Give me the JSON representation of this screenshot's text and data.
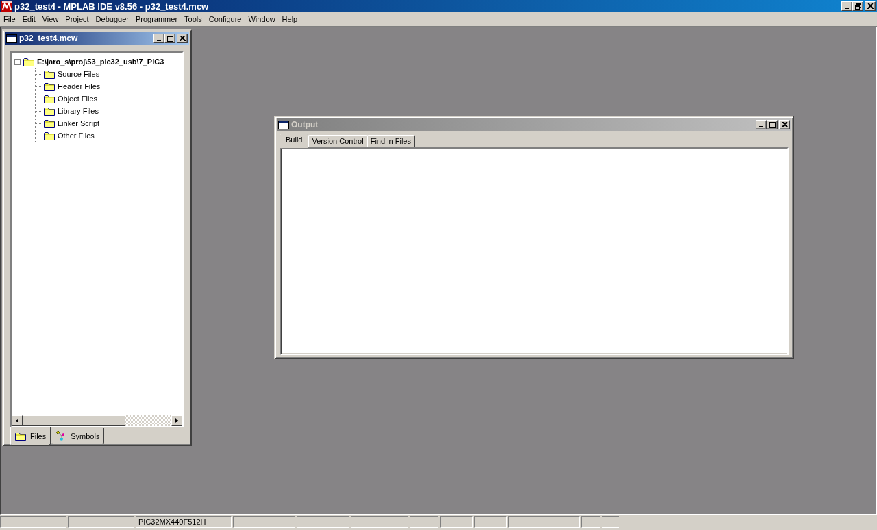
{
  "window": {
    "title": "p32_test4 - MPLAB IDE v8.56 - p32_test4.mcw"
  },
  "menu": [
    "File",
    "Edit",
    "View",
    "Project",
    "Debugger",
    "Programmer",
    "Tools",
    "Configure",
    "Window",
    "Help"
  ],
  "project_window": {
    "title": "p32_test4.mcw",
    "active": true,
    "tree": [
      {
        "label": "E:\\jaro_s\\proj\\53_pic32_usb\\7_PIC3",
        "expanded": true,
        "children": [
          {
            "label": "Source Files"
          },
          {
            "label": "Header Files"
          },
          {
            "label": "Object Files"
          },
          {
            "label": "Library Files"
          },
          {
            "label": "Linker Script"
          },
          {
            "label": "Other Files"
          }
        ]
      }
    ],
    "tabs": [
      {
        "label": "Files",
        "kind": "files",
        "selected": true
      },
      {
        "label": "Symbols",
        "kind": "symbols",
        "selected": false
      }
    ]
  },
  "output_window": {
    "title": "Output",
    "active": false,
    "tabs": [
      {
        "label": "Build",
        "selected": true
      },
      {
        "label": "Version Control",
        "selected": false
      },
      {
        "label": "Find in Files",
        "selected": false
      }
    ]
  },
  "status_bar": {
    "device": "PIC32MX440F512H"
  }
}
